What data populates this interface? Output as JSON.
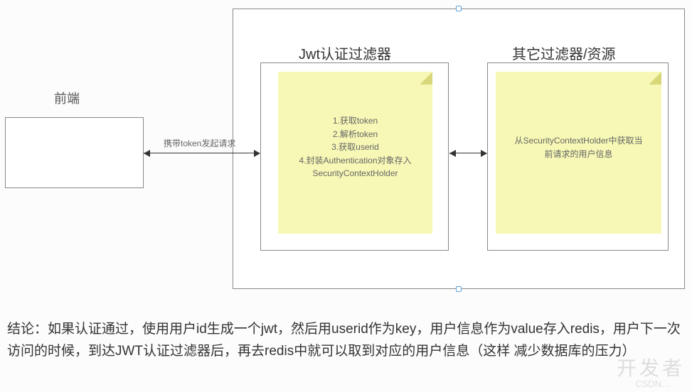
{
  "nodes": {
    "frontend": "前端",
    "jwt_filter": "Jwt认证过滤器",
    "other_filter": "其它过滤器/资源"
  },
  "note1": {
    "lines": [
      "1.获取token",
      "2.解析token",
      "3.获取userid",
      "4.封装Authentication对象存入",
      "SecurityContextHolder"
    ]
  },
  "note2": {
    "lines": [
      "从SecurityContextHolder中获取当",
      "前请求的用户信息"
    ]
  },
  "arrows": {
    "frontend_to_filter": "携带token发起请求"
  },
  "caption": "结论：如果认证通过，使用用户id生成一个jwt，然后用userid作为key，用户信息作为value存入redis，用户下一次访问的时候，到达JWT认证过滤器后，再去redis中就可以取到对应的用户信息（这样 减少数据库的压力）",
  "watermarks": {
    "brand": "开发者",
    "small": "CSDN…"
  },
  "chart_data": {
    "type": "diagram",
    "nodes": [
      {
        "id": "frontend",
        "label": "前端"
      },
      {
        "id": "container",
        "label": "",
        "children": [
          "jwt_filter_box",
          "other_filter_box"
        ]
      },
      {
        "id": "jwt_filter_box",
        "label": "Jwt认证过滤器",
        "content": [
          "1.获取token",
          "2.解析token",
          "3.获取userid",
          "4.封装Authentication对象存入",
          "SecurityContextHolder"
        ]
      },
      {
        "id": "other_filter_box",
        "label": "其它过滤器/资源",
        "content": [
          "从SecurityContextHolder中获取当前请求的用户信息"
        ]
      }
    ],
    "edges": [
      {
        "from": "frontend",
        "to": "jwt_filter_box",
        "label": "携带token发起请求",
        "bidirectional": true
      },
      {
        "from": "jwt_filter_box",
        "to": "other_filter_box",
        "bidirectional": true
      }
    ]
  }
}
